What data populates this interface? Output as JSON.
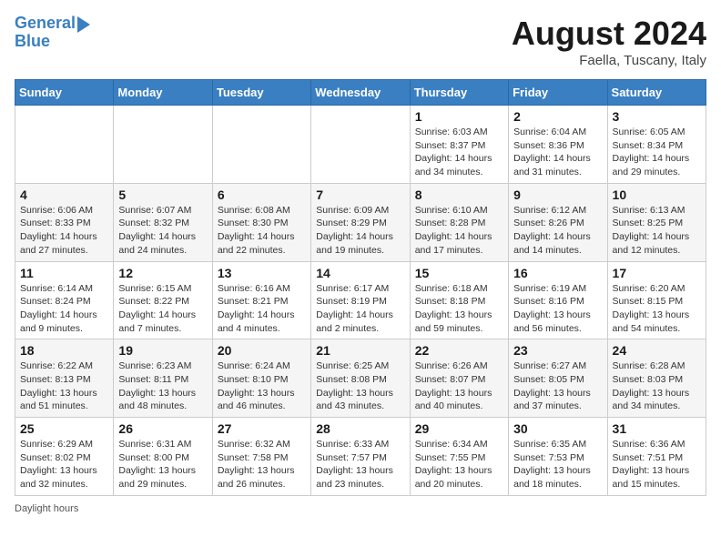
{
  "header": {
    "logo_line1": "General",
    "logo_line2": "Blue",
    "month_year": "August 2024",
    "location": "Faella, Tuscany, Italy"
  },
  "days_of_week": [
    "Sunday",
    "Monday",
    "Tuesday",
    "Wednesday",
    "Thursday",
    "Friday",
    "Saturday"
  ],
  "weeks": [
    [
      {
        "day": "",
        "info": ""
      },
      {
        "day": "",
        "info": ""
      },
      {
        "day": "",
        "info": ""
      },
      {
        "day": "",
        "info": ""
      },
      {
        "day": "1",
        "info": "Sunrise: 6:03 AM\nSunset: 8:37 PM\nDaylight: 14 hours\nand 34 minutes."
      },
      {
        "day": "2",
        "info": "Sunrise: 6:04 AM\nSunset: 8:36 PM\nDaylight: 14 hours\nand 31 minutes."
      },
      {
        "day": "3",
        "info": "Sunrise: 6:05 AM\nSunset: 8:34 PM\nDaylight: 14 hours\nand 29 minutes."
      }
    ],
    [
      {
        "day": "4",
        "info": "Sunrise: 6:06 AM\nSunset: 8:33 PM\nDaylight: 14 hours\nand 27 minutes."
      },
      {
        "day": "5",
        "info": "Sunrise: 6:07 AM\nSunset: 8:32 PM\nDaylight: 14 hours\nand 24 minutes."
      },
      {
        "day": "6",
        "info": "Sunrise: 6:08 AM\nSunset: 8:30 PM\nDaylight: 14 hours\nand 22 minutes."
      },
      {
        "day": "7",
        "info": "Sunrise: 6:09 AM\nSunset: 8:29 PM\nDaylight: 14 hours\nand 19 minutes."
      },
      {
        "day": "8",
        "info": "Sunrise: 6:10 AM\nSunset: 8:28 PM\nDaylight: 14 hours\nand 17 minutes."
      },
      {
        "day": "9",
        "info": "Sunrise: 6:12 AM\nSunset: 8:26 PM\nDaylight: 14 hours\nand 14 minutes."
      },
      {
        "day": "10",
        "info": "Sunrise: 6:13 AM\nSunset: 8:25 PM\nDaylight: 14 hours\nand 12 minutes."
      }
    ],
    [
      {
        "day": "11",
        "info": "Sunrise: 6:14 AM\nSunset: 8:24 PM\nDaylight: 14 hours\nand 9 minutes."
      },
      {
        "day": "12",
        "info": "Sunrise: 6:15 AM\nSunset: 8:22 PM\nDaylight: 14 hours\nand 7 minutes."
      },
      {
        "day": "13",
        "info": "Sunrise: 6:16 AM\nSunset: 8:21 PM\nDaylight: 14 hours\nand 4 minutes."
      },
      {
        "day": "14",
        "info": "Sunrise: 6:17 AM\nSunset: 8:19 PM\nDaylight: 14 hours\nand 2 minutes."
      },
      {
        "day": "15",
        "info": "Sunrise: 6:18 AM\nSunset: 8:18 PM\nDaylight: 13 hours\nand 59 minutes."
      },
      {
        "day": "16",
        "info": "Sunrise: 6:19 AM\nSunset: 8:16 PM\nDaylight: 13 hours\nand 56 minutes."
      },
      {
        "day": "17",
        "info": "Sunrise: 6:20 AM\nSunset: 8:15 PM\nDaylight: 13 hours\nand 54 minutes."
      }
    ],
    [
      {
        "day": "18",
        "info": "Sunrise: 6:22 AM\nSunset: 8:13 PM\nDaylight: 13 hours\nand 51 minutes."
      },
      {
        "day": "19",
        "info": "Sunrise: 6:23 AM\nSunset: 8:11 PM\nDaylight: 13 hours\nand 48 minutes."
      },
      {
        "day": "20",
        "info": "Sunrise: 6:24 AM\nSunset: 8:10 PM\nDaylight: 13 hours\nand 46 minutes."
      },
      {
        "day": "21",
        "info": "Sunrise: 6:25 AM\nSunset: 8:08 PM\nDaylight: 13 hours\nand 43 minutes."
      },
      {
        "day": "22",
        "info": "Sunrise: 6:26 AM\nSunset: 8:07 PM\nDaylight: 13 hours\nand 40 minutes."
      },
      {
        "day": "23",
        "info": "Sunrise: 6:27 AM\nSunset: 8:05 PM\nDaylight: 13 hours\nand 37 minutes."
      },
      {
        "day": "24",
        "info": "Sunrise: 6:28 AM\nSunset: 8:03 PM\nDaylight: 13 hours\nand 34 minutes."
      }
    ],
    [
      {
        "day": "25",
        "info": "Sunrise: 6:29 AM\nSunset: 8:02 PM\nDaylight: 13 hours\nand 32 minutes."
      },
      {
        "day": "26",
        "info": "Sunrise: 6:31 AM\nSunset: 8:00 PM\nDaylight: 13 hours\nand 29 minutes."
      },
      {
        "day": "27",
        "info": "Sunrise: 6:32 AM\nSunset: 7:58 PM\nDaylight: 13 hours\nand 26 minutes."
      },
      {
        "day": "28",
        "info": "Sunrise: 6:33 AM\nSunset: 7:57 PM\nDaylight: 13 hours\nand 23 minutes."
      },
      {
        "day": "29",
        "info": "Sunrise: 6:34 AM\nSunset: 7:55 PM\nDaylight: 13 hours\nand 20 minutes."
      },
      {
        "day": "30",
        "info": "Sunrise: 6:35 AM\nSunset: 7:53 PM\nDaylight: 13 hours\nand 18 minutes."
      },
      {
        "day": "31",
        "info": "Sunrise: 6:36 AM\nSunset: 7:51 PM\nDaylight: 13 hours\nand 15 minutes."
      }
    ]
  ],
  "footer": {
    "note": "Daylight hours"
  }
}
